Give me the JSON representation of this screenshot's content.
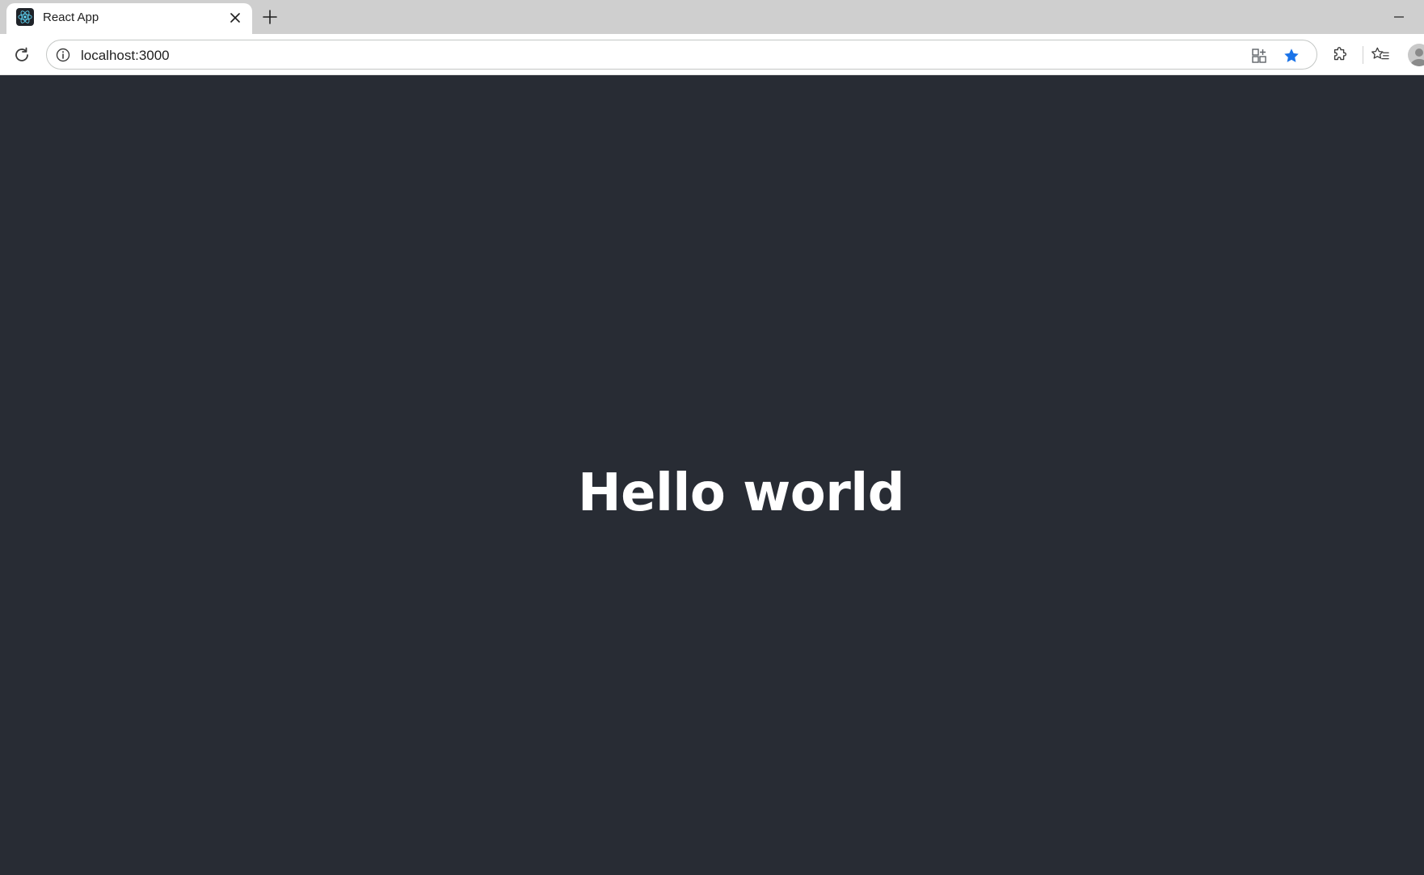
{
  "tab": {
    "title": "React App",
    "favicon": "react-logo-icon"
  },
  "toolbar": {
    "url": "localhost:3000"
  },
  "page": {
    "heading": "Hello world",
    "background_color": "#282c34",
    "text_color": "#ffffff"
  },
  "colors": {
    "bookmark_star": "#1a73e8",
    "tabstrip": "#cfcfcf"
  }
}
